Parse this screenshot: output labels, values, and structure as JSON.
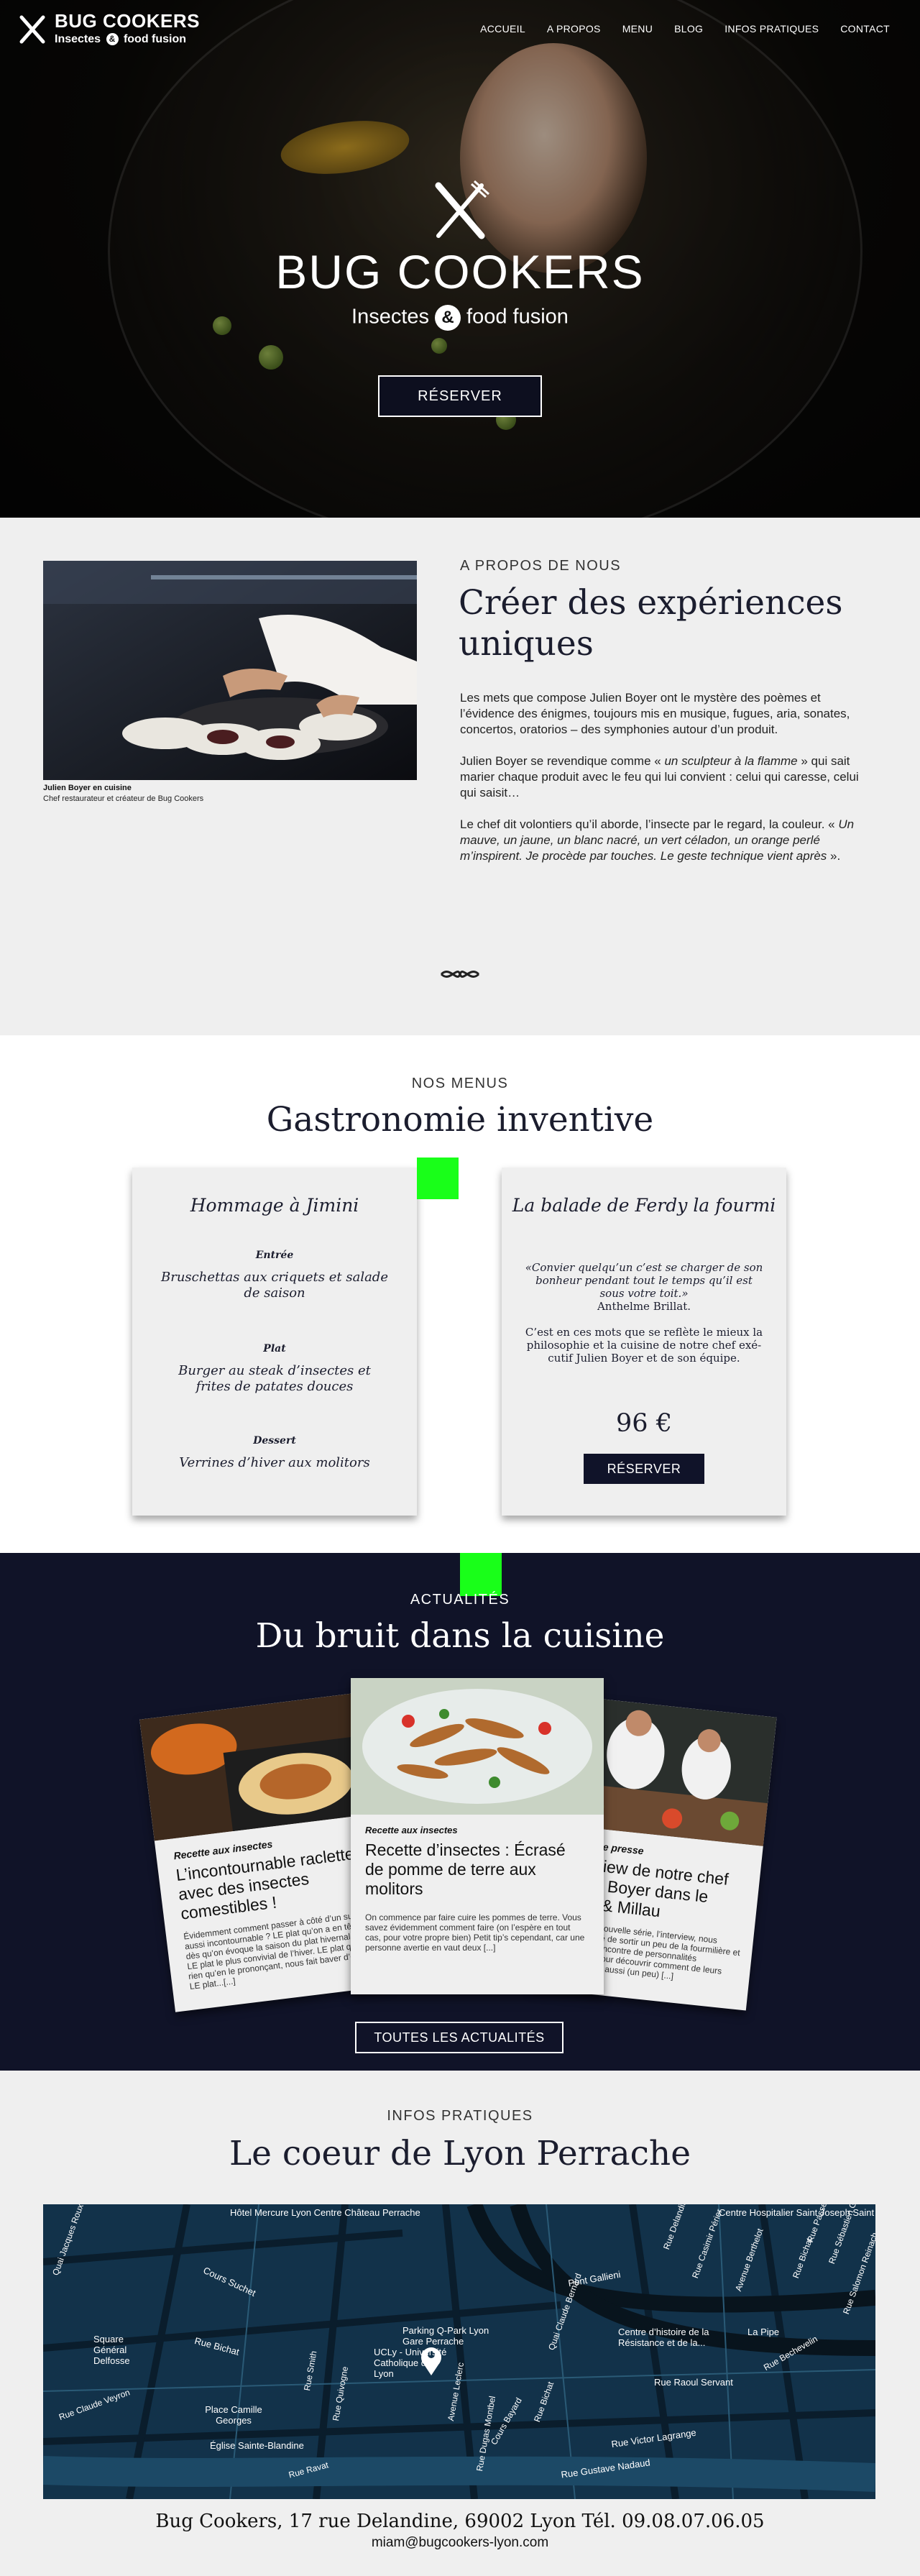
{
  "brand": {
    "title": "BUG COOKERS",
    "subtitle_left": "Insectes",
    "amp": "&",
    "subtitle_right": "food fusion"
  },
  "nav": [
    "ACCUEIL",
    "A PROPOS",
    "MENU",
    "BLOG",
    "INFOS PRATIQUES",
    "CONTACT"
  ],
  "hero": {
    "title": "BUG COOKERS",
    "subtitle_left": "Insectes",
    "amp": "&",
    "subtitle_right": "food fusion",
    "cta": "RÉSERVER"
  },
  "about": {
    "eyebrow": "A PROPOS DE NOUS",
    "title": "Créer des expériences uniques",
    "caption_name": "Julien Boyer en cuisine",
    "caption_role": "Chef restaurateur et créateur de Bug Cookers",
    "p1": "Les  mets que compose Julien Boyer ont le mystère des poèmes et  l’évidence  des énigmes, toujours mis en musique, fugues, aria, sonates,  concertos,  oratorios – des symphonies autour d’un produit.",
    "p2_a": "Julien Boyer se revendique comme « ",
    "p2_em": "un sculpteur à la flamme",
    "p2_b": " » qui sait marier chaque produit avec le feu qui lui convient : celui qui caresse, celui qui saisit…",
    "p3_a": "Le chef dit volontiers qu’il aborde, l’insecte par le regard, la couleur. « ",
    "p3_em": "Un mauve, un jaune, un blanc nacré, un vert céladon, un    orange perlé m’inspirent. Je procède par touches. Le geste technique vient après",
    "p3_b": " »."
  },
  "menus": {
    "eyebrow": "NOS MENUS",
    "title": "Gastronomie inventive",
    "card1": {
      "title": "Hommage à Jimini",
      "courses": [
        {
          "category": "Entrée",
          "dish": "Bruschettas aux criquets et salade de saison"
        },
        {
          "category": "Plat",
          "dish": "Burger au steak d’insectes et frites de patates douces"
        },
        {
          "category": "Dessert",
          "dish": "Verrines d’hiver aux molitors"
        }
      ]
    },
    "card2": {
      "title": "La balade de Ferdy la fourmi",
      "quote": "«Convier quelqu’un c’est se charger de son bonheur pendant tout le temps qu’il est sous votre toit.»",
      "quote_author": "Anthelme Brillat.",
      "text": "C’est en ces mots que se reflète le mieux la philosophie et la cuisine de notre chef exé-cutif Julien Boyer et de son équipe.",
      "price": "96 €",
      "cta": "RÉSERVER"
    }
  },
  "news": {
    "eyebrow": "ACTUALITÉS",
    "title": "Du bruit dans la cuisine",
    "cards": [
      {
        "tag": "Recette aux insectes",
        "title": "L’incontournable raclette avec des insectes comestibles !",
        "excerpt": "Évidemment comment passer à côté d’un sujet aussi incontournable ? LE plat qu’on a en  tête dès qu’on évoque la saison du plat hivernal «. LE plat le plus  convivial de l’hiver. LE plat qui, rien qu’en le prononçant, nous fait baver d’envie. LE plat...[...]"
      },
      {
        "tag": "Recette aux insectes",
        "title": "Recette d’insectes : Écrasé de pomme de terre aux molitors",
        "excerpt": "On commence par faire cuire les pommes de terre. Vous savez évidemment comment faire (on l’espère en tout cas, pour votre propre bien)  Petit tip’s cependant, car une personne avertie en vaut deux [...]"
      },
      {
        "tag": "Revue de presse",
        "title": "Interview de notre chef Julien Boyer dans le Gault & Millau",
        "excerpt": "Dans cette nouvelle série, l’interview, nous  avons décidé de sortir un peu de la fourmilière et d’aller à la rencontre de personnalités inspirantes pour découvrir comment de  leurs intérêts, mais aussi (un peu) [...]"
      }
    ],
    "cta": "TOUTES LES ACTUALITÉS"
  },
  "infos": {
    "eyebrow": "INFOS PRATIQUES",
    "title": "Le coeur de Lyon Perrache",
    "address": "Bug Cookers, 17 rue Delandine, 69002 Lyon Tél. 09.08.07.06.05",
    "email": "miam@bugcookers-lyon.com",
    "map_labels": [
      "Hôtel Mercure Lyon Centre Château Perrache",
      "Centre Hospitalier Saint Joseph Saint Luc",
      "Cours Suchet",
      "Rue Bichat",
      "Square Général Delfosse",
      "Place Camille Georges",
      "Église Sainte-Blandine",
      "Parking Q-Park Lyon Gare Perrache",
      "UCLy - Université Catholique de Lyon",
      "Centre d’histoire de la Résistance et de la...",
      "La Pipe",
      "Pont Gallieni",
      "Rue Raoul Servant",
      "Rue Victor Lagrange",
      "Rue Gustave Nadaud",
      "Quai Jacques Roux",
      "Cours Bayard",
      "Avenue Berthelot",
      "Rue Bechevelin",
      "Rue Sébastien Gryphe",
      "Rue Smith",
      "Rue Quivogne",
      "Rue Ravat",
      "Rue Dugas Montbel",
      "Rue Delandine",
      "Rue Casimir Périer",
      "Rue Bichat",
      "Avenue Leclerc",
      "Rue Bichat",
      "Rue Salomon Reinach",
      "Rue Claude Veyron",
      "Rue Passet",
      "Quai Claude Bernard"
    ]
  }
}
